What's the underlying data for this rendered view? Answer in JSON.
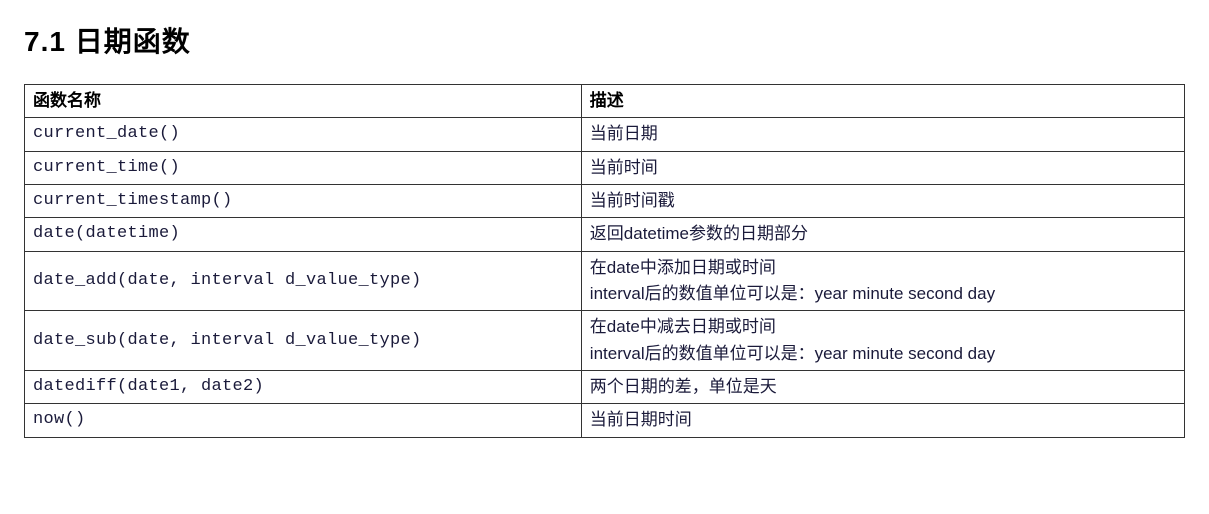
{
  "heading": "7.1 日期函数",
  "table": {
    "headers": {
      "name": "函数名称",
      "desc": "描述"
    },
    "rows": [
      {
        "fn": "current_date()",
        "desc": "当前日期"
      },
      {
        "fn": "current_time()",
        "desc": "当前时间"
      },
      {
        "fn": "current_timestamp()",
        "desc": "当前时间戳"
      },
      {
        "fn": "date(datetime)",
        "desc": "返回datetime参数的日期部分"
      },
      {
        "fn": "date_add(date, interval d_value_type)",
        "desc_lines": [
          "在date中添加日期或时间",
          "interval后的数值单位可以是：year minute second day"
        ]
      },
      {
        "fn": "date_sub(date, interval d_value_type)",
        "desc_lines": [
          "在date中减去日期或时间",
          "interval后的数值单位可以是：year minute second day"
        ]
      },
      {
        "fn": "datediff(date1, date2)",
        "desc": "两个日期的差，单位是天"
      },
      {
        "fn": "now()",
        "desc": "当前日期时间"
      }
    ]
  }
}
